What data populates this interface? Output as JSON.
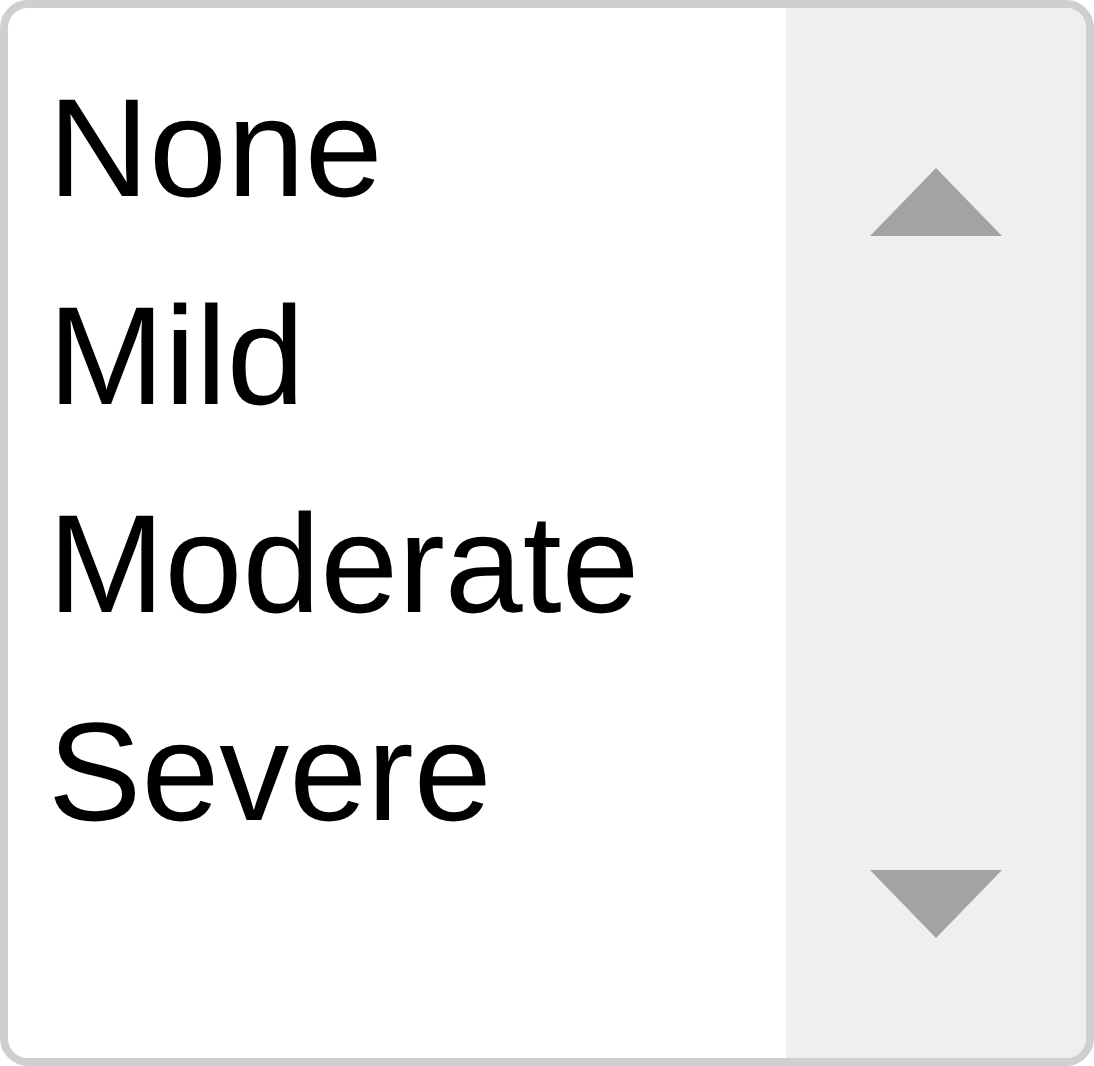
{
  "listbox": {
    "options": [
      {
        "label": "None"
      },
      {
        "label": "Mild"
      },
      {
        "label": "Moderate"
      },
      {
        "label": "Severe"
      }
    ]
  }
}
